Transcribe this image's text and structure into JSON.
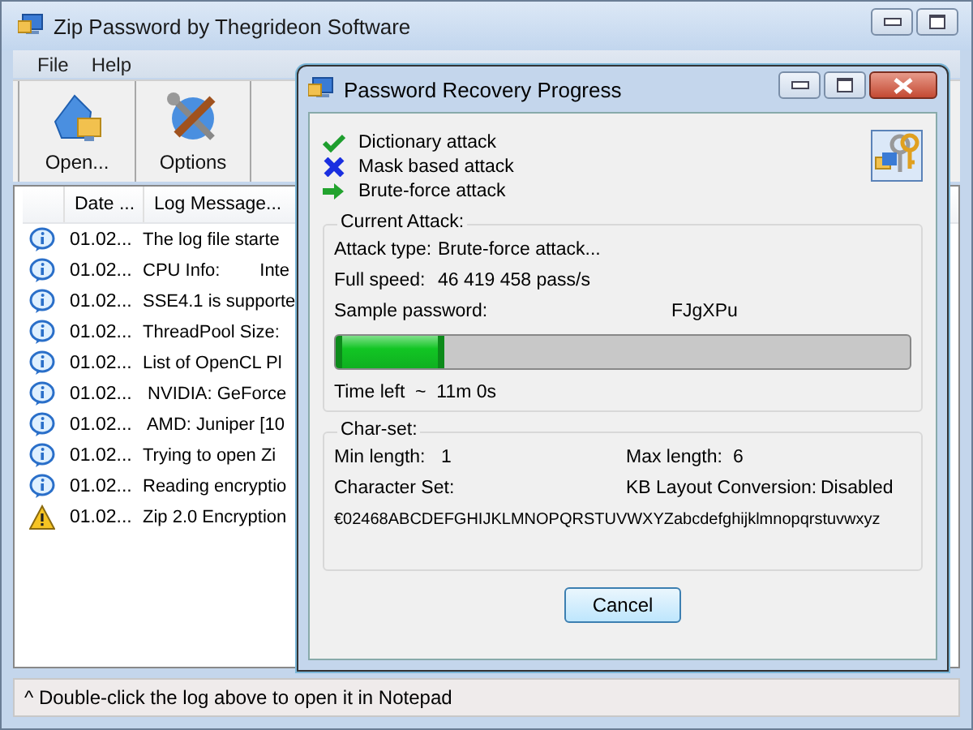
{
  "window": {
    "title": "Zip Password by Thegrideon Software"
  },
  "menu": [
    "File",
    "Help"
  ],
  "toolbar": [
    {
      "label": "Open...",
      "kind": "open"
    },
    {
      "label": "Options",
      "kind": "options"
    }
  ],
  "log": {
    "columns": [
      "Date ...",
      "Log Message..."
    ],
    "rows": [
      {
        "kind": "info",
        "date": "01.02...",
        "message": "The log file starte"
      },
      {
        "kind": "info",
        "date": "01.02...",
        "message": "CPU Info:        Inte"
      },
      {
        "kind": "info",
        "date": "01.02...",
        "message": "SSE4.1 is supporte"
      },
      {
        "kind": "info",
        "date": "01.02...",
        "message": "ThreadPool Size:"
      },
      {
        "kind": "info",
        "date": "01.02...",
        "message": "List of OpenCL Pl"
      },
      {
        "kind": "info",
        "date": "01.02...",
        "message": " NVIDIA: GeForce"
      },
      {
        "kind": "info",
        "date": "01.02...",
        "message": " AMD: Juniper [10"
      },
      {
        "kind": "info",
        "date": "01.02...",
        "message": "Trying to open Zi"
      },
      {
        "kind": "info",
        "date": "01.02...",
        "message": "Reading encryptio"
      },
      {
        "kind": "warning",
        "date": "01.02...",
        "message": "Zip 2.0 Encryption"
      }
    ]
  },
  "status_bar": "^ Double-click the log above to open it in Notepad",
  "dialog": {
    "title": "Password Recovery Progress",
    "attacks": [
      {
        "kind": "done",
        "label": "Dictionary attack"
      },
      {
        "kind": "skipped",
        "label": "Mask based attack"
      },
      {
        "kind": "current",
        "label": "Brute-force attack"
      }
    ],
    "current_attack": {
      "title": "Current Attack:",
      "attack_type_label": "Attack type:",
      "attack_type": "Brute-force attack...",
      "speed_label": "Full speed:",
      "speed": "46 419 458 pass/s",
      "sample_label": "Sample password:",
      "sample": "FJgXPu",
      "level": 0.19,
      "time_left": "Time left  ~  11m 0s"
    },
    "charset": {
      "title": "Char-set:",
      "min_label": "Min length:",
      "min": "1",
      "max_label": "Max length:",
      "max": "6",
      "set_label": "Character Set:",
      "kb_label": "KB Layout Conversion:",
      "kb": "Disabled",
      "chars": "€02468ABCDEFGHIJKLMNOPQRSTUVWXYZabcdefghijklmnopqrstuvwxyz"
    },
    "cancel": "Cancel"
  }
}
